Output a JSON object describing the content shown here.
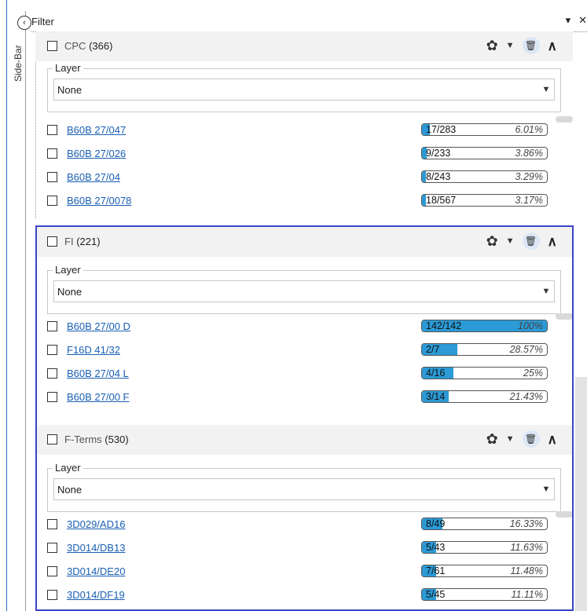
{
  "sidebar": {
    "label": "Side-Bar",
    "collapse_glyph": "‹"
  },
  "filter_panel": {
    "title": "Filter",
    "menu_glyph": "▾",
    "close_glyph": "✕"
  },
  "sections": [
    {
      "name": "CPC",
      "count": "(366)",
      "layer_label": "Layer",
      "layer_value": "None",
      "items": [
        {
          "code": "B60B 27/047",
          "ratio": "17/283",
          "percent": "6.01%",
          "fill": 0.0601
        },
        {
          "code": "B60B 27/026",
          "ratio": "9/233",
          "percent": "3.86%",
          "fill": 0.0386
        },
        {
          "code": "B60B 27/04",
          "ratio": "8/243",
          "percent": "3.29%",
          "fill": 0.0329
        },
        {
          "code": "B60B 27/0078",
          "ratio": "18/567",
          "percent": "3.17%",
          "fill": 0.0317
        }
      ]
    },
    {
      "name": "FI",
      "count": "(221)",
      "layer_label": "Layer",
      "layer_value": "None",
      "items": [
        {
          "code": "B60B 27/00 D",
          "ratio": "142/142",
          "percent": "100%",
          "fill": 1.0
        },
        {
          "code": "F16D 41/32",
          "ratio": "2/7",
          "percent": "28.57%",
          "fill": 0.2857
        },
        {
          "code": "B60B 27/04 L",
          "ratio": "4/16",
          "percent": "25%",
          "fill": 0.25
        },
        {
          "code": "B60B 27/00 F",
          "ratio": "3/14",
          "percent": "21.43%",
          "fill": 0.2143
        }
      ]
    },
    {
      "name": "F-Terms",
      "count": "(530)",
      "layer_label": "Layer",
      "layer_value": "None",
      "items": [
        {
          "code": "3D029/AD16",
          "ratio": "8/49",
          "percent": "16.33%",
          "fill": 0.1633
        },
        {
          "code": "3D014/DB13",
          "ratio": "5/43",
          "percent": "11.63%",
          "fill": 0.1163
        },
        {
          "code": "3D014/DE20",
          "ratio": "7/61",
          "percent": "11.48%",
          "fill": 0.1148
        },
        {
          "code": "3D014/DF19",
          "ratio": "5/45",
          "percent": "11.11%",
          "fill": 0.1111
        }
      ]
    }
  ],
  "colors": {
    "accent": "#3b45c7",
    "bar_fill": "#2b9ad6",
    "link": "#1a5fb4"
  }
}
